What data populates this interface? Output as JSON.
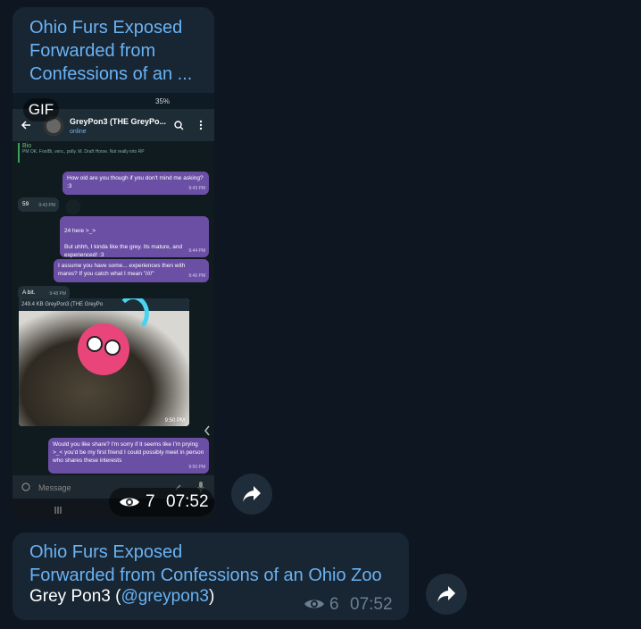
{
  "messages": [
    {
      "channel": "Ohio Furs Exposed",
      "forwarded_line1": "Forwarded from",
      "forwarded_line2": "Confessions of an ...",
      "media_type": "GIF",
      "views": "7",
      "time": "07:52",
      "screenshot": {
        "status_battery": "35%",
        "contact_name": "GreyPon3 (THE GreyPo...",
        "contact_status": "online",
        "bio_title": "Bio",
        "bio_text": "PM OK. Fon/Bi, vers., polly. M. Draft Horse. Not really into RP",
        "chat": [
          {
            "dir": "out",
            "text": "How old are you though if you don't mind me asking? :3",
            "time": "9:43 PM"
          },
          {
            "dir": "in",
            "text": "59",
            "time": "9:43 PM"
          },
          {
            "dir": "out",
            "text": "24 here >_>\n\nBut uhhh, I kinda like the grey. Its mature, and experienced! :3",
            "time": "9:44 PM"
          },
          {
            "dir": "out",
            "text": "I assume you have some... experiences then with mares? If you catch what I mean \"////\"",
            "time": "9:46 PM"
          },
          {
            "dir": "in",
            "text": "A bit.",
            "time": "9:48 PM"
          },
          {
            "dir": "out",
            "text": "Would you like share? I'm sorry if it seems like I'm prying >_< you'd be my first friend I could possibly meet in person who shares these interests",
            "time": "9:50 PM"
          }
        ],
        "gif_caption": "249.4 KB GreyPon3 (THE GreyPo",
        "gif_time": "9:50 PM",
        "compose_placeholder": "Message"
      }
    },
    {
      "channel": "Ohio Furs Exposed",
      "forwarded": "Forwarded from Confessions of an Ohio Zoo",
      "author_name": "Grey Pon3 (",
      "author_handle": "@greypon3",
      "author_close": ")",
      "views": "6",
      "time": "07:52"
    }
  ],
  "icons": {
    "views": "eye-icon",
    "forward": "share-arrow-icon"
  }
}
